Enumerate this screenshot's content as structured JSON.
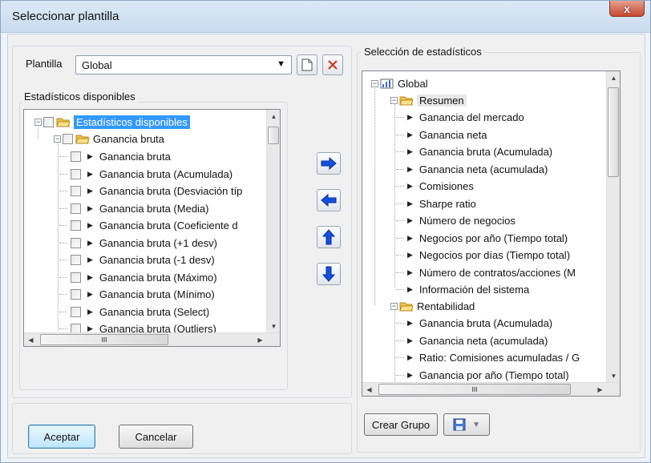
{
  "window": {
    "title": "Seleccionar plantilla",
    "close_label": "x"
  },
  "plantilla": {
    "label": "Plantilla",
    "value": "Global"
  },
  "left_panel": {
    "title": "Estadísticos disponibles",
    "root": "Estadísticos disponibles",
    "group": "Ganancia bruta",
    "items": [
      "Ganancia bruta",
      "Ganancia bruta (Acumulada)",
      "Ganancia bruta (Desviación típ",
      "Ganancia bruta (Media)",
      "Ganancia bruta (Coeficiente d",
      "Ganancia bruta (+1 desv)",
      "Ganancia bruta (-1 desv)",
      "Ganancia bruta (Máximo)",
      "Ganancia bruta (Mínimo)",
      "Ganancia bruta (Select)",
      "Ganancia bruta (Outliers)"
    ],
    "hscroll_thumb_label": "III"
  },
  "right_panel": {
    "title": "Selección de estadísticos",
    "root": "Global",
    "group1": "Resumen",
    "group1_items": [
      "Ganancia del mercado",
      "Ganancia neta",
      "Ganancia bruta (Acumulada)",
      "Ganancia neta (acumulada)",
      "Comisiones",
      "Sharpe ratio",
      "Número de negocios",
      "Negocios por año (Tiempo total)",
      "Negocios por días (Tiempo total)",
      "Número de contratos/acciones (M",
      "Información del sistema"
    ],
    "group2": "Rentabilidad",
    "group2_items": [
      "Ganancia bruta (Acumulada)",
      "Ganancia neta (acumulada)",
      "Ratio: Comisiones acumuladas / G",
      "Ganancia por año (Tiempo total)"
    ],
    "hscroll_thumb_label": "III"
  },
  "buttons": {
    "crear_grupo": "Crear Grupo",
    "aceptar": "Aceptar",
    "cancelar": "Cancelar"
  }
}
